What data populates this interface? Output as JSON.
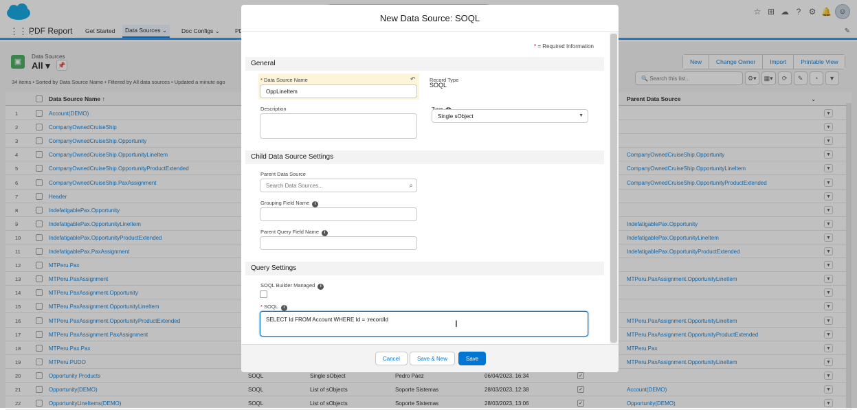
{
  "app": {
    "name": "PDF Report",
    "nav": [
      "Get Started",
      "Data Sources",
      "Doc Configs",
      "PD"
    ],
    "active_nav": "Data Sources"
  },
  "listview": {
    "object": "Data Sources",
    "view": "All",
    "meta": "34 items • Sorted by Data Source Name • Filtered by All data sources • Updated a minute ago",
    "buttons": [
      "New",
      "Change Owner",
      "Import",
      "Printable View"
    ],
    "search_placeholder": "Search this list...",
    "col_name": "Data Source Name",
    "col_parent": "Parent Data Source",
    "rows": [
      {
        "n": "1",
        "name": "Account(DEMO)",
        "t": "",
        "q": "",
        "o": "",
        "d": "",
        "p": ""
      },
      {
        "n": "2",
        "name": "CompanyOwnedCruiseShip",
        "t": "",
        "q": "",
        "o": "",
        "d": "",
        "p": ""
      },
      {
        "n": "3",
        "name": "CompanyOwnedCruiseShip.Opportunity",
        "t": "",
        "q": "",
        "o": "",
        "d": "",
        "p": ""
      },
      {
        "n": "4",
        "name": "CompanyOwnedCruiseShip.OpportunityLineItem",
        "t": "",
        "q": "",
        "o": "",
        "d": "",
        "p": "CompanyOwnedCruiseShip.Opportunity"
      },
      {
        "n": "5",
        "name": "CompanyOwnedCruiseShip.OpportunityProductExtended",
        "t": "",
        "q": "",
        "o": "",
        "d": "",
        "p": "CompanyOwnedCruiseShip.OpportunityLineItem"
      },
      {
        "n": "6",
        "name": "CompanyOwnedCruiseShip.PaxAssignment",
        "t": "",
        "q": "",
        "o": "",
        "d": "",
        "p": "CompanyOwnedCruiseShip.OpportunityProductExtended"
      },
      {
        "n": "7",
        "name": "Header",
        "t": "",
        "q": "",
        "o": "",
        "d": "",
        "p": ""
      },
      {
        "n": "8",
        "name": "IndefatigablePax.Opportunity",
        "t": "",
        "q": "",
        "o": "",
        "d": "",
        "p": ""
      },
      {
        "n": "9",
        "name": "IndefatigablePax.OpportunityLineItem",
        "t": "",
        "q": "",
        "o": "",
        "d": "",
        "p": "IndefatigablePax.Opportunity"
      },
      {
        "n": "10",
        "name": "IndefatigablePax.OpportunityProductExtended",
        "t": "",
        "q": "",
        "o": "",
        "d": "",
        "p": "IndefatigablePax.OpportunityLineItem"
      },
      {
        "n": "11",
        "name": "IndefatigablePax.PaxAssignment",
        "t": "",
        "q": "",
        "o": "",
        "d": "",
        "p": "IndefatigablePax.OpportunityProductExtended"
      },
      {
        "n": "12",
        "name": "MTPeru.Pax",
        "t": "",
        "q": "",
        "o": "",
        "d": "",
        "p": ""
      },
      {
        "n": "13",
        "name": "MTPeru.PaxAssignment",
        "t": "",
        "q": "",
        "o": "",
        "d": "",
        "p": "MTPeru.PaxAssignment.OpportunityLineItem"
      },
      {
        "n": "14",
        "name": "MTPeru.PaxAssignment.Opportunity",
        "t": "",
        "q": "",
        "o": "",
        "d": "",
        "p": ""
      },
      {
        "n": "15",
        "name": "MTPeru.PaxAssignment.OpportunityLineItem",
        "t": "",
        "q": "",
        "o": "",
        "d": "",
        "p": ""
      },
      {
        "n": "16",
        "name": "MTPeru.PaxAssignment.OpportunityProductExtended",
        "t": "",
        "q": "",
        "o": "",
        "d": "",
        "p": "MTPeru.PaxAssignment.OpportunityLineItem"
      },
      {
        "n": "17",
        "name": "MTPeru.PaxAssignment.PaxAssignment",
        "t": "",
        "q": "",
        "o": "",
        "d": "",
        "p": "MTPeru.PaxAssignment.OpportunityProductExtended"
      },
      {
        "n": "18",
        "name": "MTPeru.Pax.Pax",
        "t": "",
        "q": "",
        "o": "",
        "d": "",
        "p": "MTPeru.Pax"
      },
      {
        "n": "19",
        "name": "MTPeru.PUDO",
        "t": "",
        "q": "",
        "o": "",
        "d": "",
        "p": "MTPeru.PaxAssignment.OpportunityLineItem"
      },
      {
        "n": "20",
        "name": "Opportunity Products",
        "t": "SOQL",
        "q": "Single sObject",
        "o": "Pedro Páez",
        "d": "06/04/2023, 16:34",
        "p": ""
      },
      {
        "n": "21",
        "name": "Opportunity(DEMO)",
        "t": "SOQL",
        "q": "List of sObjects",
        "o": "Soporte Sistemas",
        "d": "28/03/2023, 12:38",
        "p": "Account(DEMO)"
      },
      {
        "n": "22",
        "name": "OpportunityLineItems(DEMO)",
        "t": "SOQL",
        "q": "List of sObjects",
        "o": "Soporte Sistemas",
        "d": "28/03/2023, 13:06",
        "p": "Opportunity(DEMO)"
      }
    ]
  },
  "modal": {
    "title": "New Data Source: SOQL",
    "required_note": "= Required Information",
    "section_general": "General",
    "label_name": "Data Source Name",
    "value_name": "OppLineItem",
    "label_record_type": "Record Type",
    "value_record_type": "SOQL",
    "label_description": "Description",
    "label_type": "Type",
    "value_type": "Single sObject",
    "section_child": "Child Data Source Settings",
    "label_parent": "Parent Data Source",
    "placeholder_parent": "Search Data Sources...",
    "label_grouping": "Grouping Field Name",
    "label_parent_query": "Parent Query Field Name",
    "section_query": "Query Settings",
    "label_builder": "SOQL Builder Managed",
    "label_soql": "SOQL",
    "value_soql": "SELECT Id FROM Account WHERE Id = :recordId",
    "btn_cancel": "Cancel",
    "btn_save_new": "Save & New",
    "btn_save": "Save"
  },
  "colors": {
    "brand": "#0176d3",
    "required": "#ba0517",
    "highlight": "#fdf4d9"
  }
}
